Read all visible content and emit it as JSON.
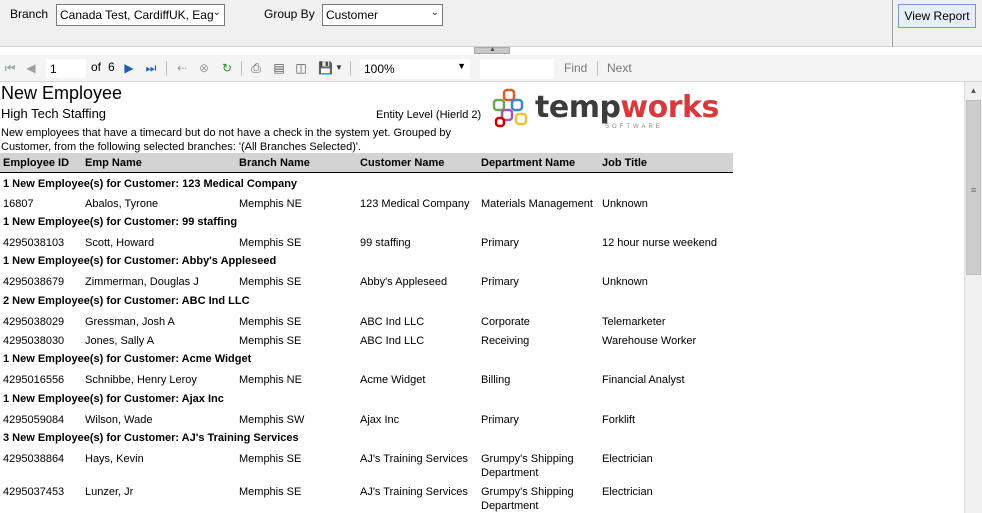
{
  "params": {
    "branch_label": "Branch",
    "branch_value": "Canada Test, CardiffUK, Eag",
    "groupby_label": "Group By",
    "groupby_value": "Customer",
    "view_report": "View Report"
  },
  "toolbar": {
    "page": "1",
    "of_label": "of",
    "total_pages": "6",
    "zoom": "100%",
    "find_label": "Find",
    "next_label": "Next"
  },
  "report": {
    "title": "New Employee",
    "company": "High Tech Staffing",
    "entity_level": "Entity Level (Hierld 2)",
    "logo_text_a": "temp",
    "logo_text_b": "works",
    "logo_sub": "SOFTWARE",
    "description": "New employees that have a timecard but do not have a check in the system yet.  Grouped by Customer, from the following selected branches: '(All Branches Selected)'.",
    "columns": [
      "Employee ID",
      "Emp Name",
      "Branch Name",
      "Customer Name",
      "Department Name",
      "Job Title"
    ],
    "groups": [
      {
        "header": "1 New Employee(s) for Customer: 123 Medical Company",
        "rows": [
          [
            "16807",
            "Abalos, Tyrone",
            "Memphis NE",
            "123 Medical Company",
            "Materials Management",
            "Unknown"
          ]
        ]
      },
      {
        "header": "1 New Employee(s) for Customer: 99 staffing",
        "rows": [
          [
            "4295038103",
            "Scott, Howard",
            "Memphis SE",
            "99 staffing",
            "Primary",
            "12 hour nurse weekend"
          ]
        ]
      },
      {
        "header": "1 New Employee(s) for Customer: Abby's Appleseed",
        "rows": [
          [
            "4295038679",
            "Zimmerman, Douglas J",
            "Memphis SE",
            "Abby's Appleseed",
            "Primary",
            "Unknown"
          ]
        ]
      },
      {
        "header": "2 New Employee(s) for Customer: ABC Ind LLC",
        "rows": [
          [
            "4295038029",
            "Gressman, Josh A",
            "Memphis SE",
            "ABC Ind LLC",
            "Corporate",
            "Telemarketer"
          ],
          [
            "4295038030",
            "Jones, Sally A",
            "Memphis SE",
            "ABC Ind LLC",
            "Receiving",
            "Warehouse Worker"
          ]
        ]
      },
      {
        "header": "1 New Employee(s) for Customer: Acme Widget",
        "rows": [
          [
            "4295016556",
            "Schnibbe, Henry Leroy",
            "Memphis NE",
            "Acme Widget",
            "Billing",
            "Financial Analyst"
          ]
        ]
      },
      {
        "header": "1 New Employee(s) for Customer: Ajax Inc",
        "rows": [
          [
            "4295059084",
            "Wilson, Wade",
            "Memphis SW",
            "Ajax Inc",
            "Primary",
            "Forklift"
          ]
        ]
      },
      {
        "header": "3 New Employee(s) for Customer: AJ's Training Services",
        "rows": [
          [
            "4295038864",
            "Hays, Kevin",
            "Memphis SE",
            "AJ's Training Services",
            "Grumpy's Shipping Department",
            "Electrician"
          ],
          [
            "4295037453",
            "Lunzer, Jr",
            "Memphis SE",
            "AJ's Training Services",
            "Grumpy's Shipping Department",
            "Electrician"
          ]
        ]
      }
    ]
  }
}
